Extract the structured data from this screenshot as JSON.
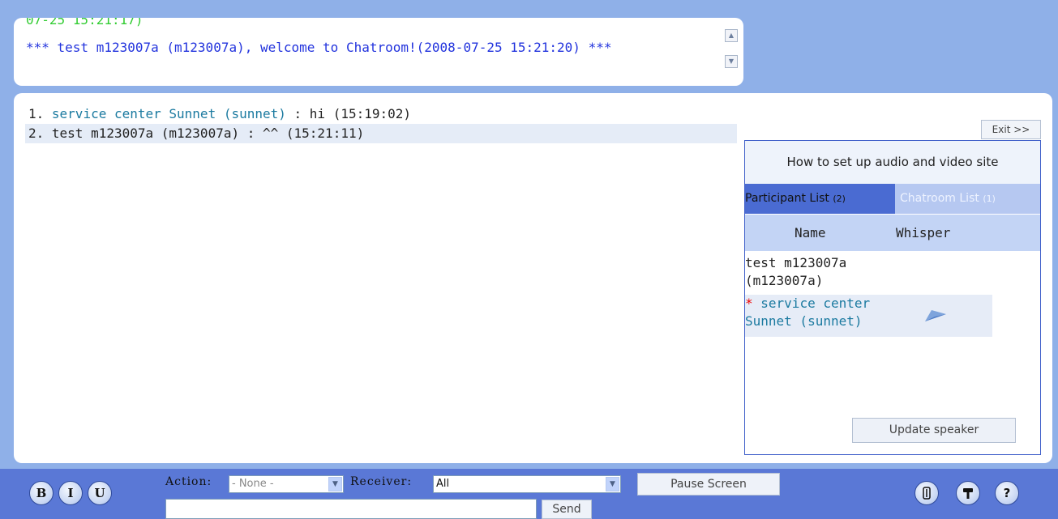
{
  "system": {
    "cut_text": "07-25 15:21:17)",
    "welcome_message": "*** test m123007a (m123007a), welcome to Chatroom!(2008-07-25 15:21:20) ***",
    "scroll_up_icon": "arrow-up-icon",
    "scroll_down_icon": "arrow-down-icon"
  },
  "chat": {
    "messages": [
      {
        "num": "1.",
        "sender": "service center Sunnet (sunnet)",
        "text": " : hi (15:19:02)"
      },
      {
        "num": "2.",
        "sender": "test m123007a (m123007a)",
        "text": " : ^^ (15:21:11)"
      }
    ]
  },
  "sidebar": {
    "exit_label": "Exit >>",
    "help_link": "How to set up audio and video site",
    "tabs": [
      {
        "label": "Participant List",
        "count": "(2)"
      },
      {
        "label": "Chatroom List",
        "count": "(1)"
      }
    ],
    "columns": {
      "name": "Name",
      "whisper": "Whisper"
    },
    "participants": [
      {
        "name_line1": "test m123007a",
        "name_line2": "(m123007a)"
      },
      {
        "marker": "*",
        "name_line1": " service center",
        "name_line2": "Sunnet (sunnet)"
      }
    ],
    "whisper_icon": "paper-plane-icon",
    "update_label": "Update speaker"
  },
  "toolbar": {
    "bold_label": "B",
    "italic_label": "I",
    "underline_label": "U",
    "action_label": "Action:",
    "action_value": "- None -",
    "receiver_label": "Receiver:",
    "receiver_value": "All",
    "pause_label": "Pause Screen",
    "send_label": "Send",
    "message_value": "",
    "right_icons": [
      "attachment-icon",
      "tools-icon",
      "help-icon"
    ],
    "help_glyph": "?"
  },
  "colors": {
    "background": "#8fb0e8",
    "bottom_bar": "#5a78d6",
    "tab_active": "#4a6bd2",
    "tab_inactive": "#b6c8f1",
    "sender_blue": "#1b7aa0",
    "system_blue": "#2233dd"
  }
}
